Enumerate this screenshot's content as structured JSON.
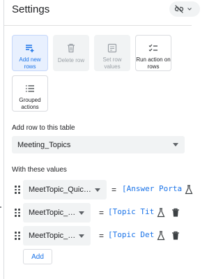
{
  "header": {
    "title": "Settings"
  },
  "actions": [
    {
      "label": "Add new rows",
      "state": "selected"
    },
    {
      "label": "Delete row",
      "state": "disabled"
    },
    {
      "label": "Set row values",
      "state": "disabled"
    },
    {
      "label": "Run action on rows",
      "state": "normal"
    },
    {
      "label": "Grouped actions",
      "state": "normal"
    }
  ],
  "table_section": {
    "label": "Add row to this table",
    "value": "Meeting_Topics"
  },
  "values_section": {
    "label": "With these values"
  },
  "rows": [
    {
      "column": "MeetTopic_Quic…",
      "operator": "=",
      "expression": "[Answer Porta"
    },
    {
      "column": "MeetTopic_…",
      "operator": "=",
      "expression": "[Topic Tit"
    },
    {
      "column": "MeetTopic_…",
      "operator": "=",
      "expression": "[Topic Det"
    }
  ],
  "add_button": {
    "label": "Add"
  },
  "colors": {
    "accent": "#1a73e8",
    "selected_bg": "#e8f0fe",
    "field_bg": "#f1f3f4"
  }
}
